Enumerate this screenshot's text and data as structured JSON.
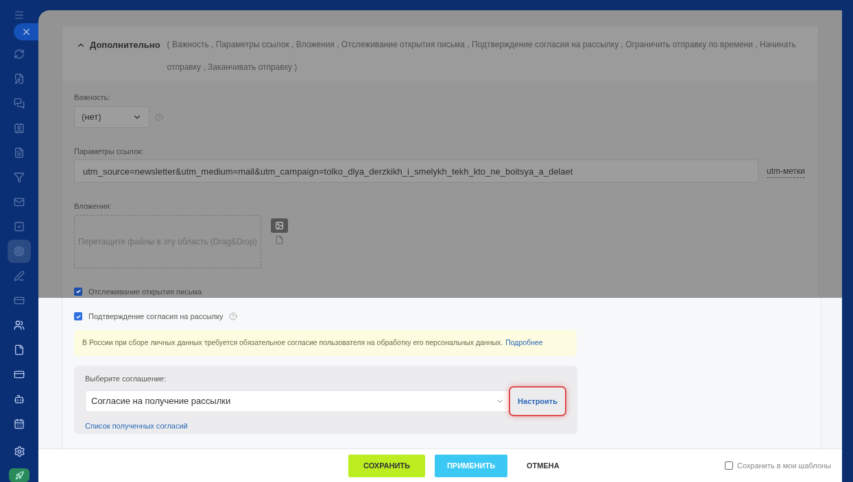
{
  "sidebar": {
    "items": [
      {
        "selected": false
      },
      {
        "selected": false
      },
      {
        "selected": false
      },
      {
        "selected": false
      },
      {
        "selected": false
      },
      {
        "selected": false
      },
      {
        "selected": false
      },
      {
        "selected": false
      },
      {
        "selected": true
      },
      {
        "selected": false
      },
      {
        "selected": false
      },
      {
        "selected": false
      },
      {
        "selected": false
      },
      {
        "selected": false
      },
      {
        "selected": false
      },
      {
        "selected": false
      }
    ]
  },
  "additional": {
    "title": "Дополнительно",
    "expanded": true,
    "summary": "( Важность ,  Параметры ссылок ,  Вложения ,  Отслеживание открытия письма ,  Подтверждение согласия на рассылку ,  Ограничить отправку по времени ,  Начинать отправку ,  Заканчивать отправку  )"
  },
  "importance": {
    "label": "Важность:",
    "value": "(нет)"
  },
  "links": {
    "label": "Параметры ссылок:",
    "value": "utm_source=newsletter&utm_medium=mail&utm_campaign=tolko_dlya_derzkikh_i_smelykh_tekh_kto_ne_boitsya_a_delaet",
    "link": "utm-метки"
  },
  "attachments": {
    "label": "Вложения:",
    "placeholder": "Перетащите файлы в эту область (Drag&Drop)"
  },
  "tracking": {
    "label": "Отслеживание открытия письма",
    "checked": true
  },
  "consent": {
    "label": "Подтверждение согласия на рассылку",
    "checked": true,
    "notice": "В России при сборе личных данных требуется обязательное согласие пользователя на обработку его персональных данных.",
    "notice_link": "Подробнее",
    "agreement_label": "Выберите соглашение:",
    "agreement_value": "Согласие на получение рассылки",
    "configure": {
      "label": "Настроить",
      "highlighted": true
    },
    "list_link": "Список полученных согласий"
  },
  "footer": {
    "buttons": [
      {
        "kind": "save",
        "label": "СОХРАНИТЬ"
      },
      {
        "kind": "apply",
        "label": "ПРИМЕНИТЬ"
      },
      {
        "kind": "cancel",
        "label": "ОТМЕНА"
      }
    ],
    "template": {
      "label": "Сохранить в мои шаблоны",
      "checked": false
    }
  }
}
